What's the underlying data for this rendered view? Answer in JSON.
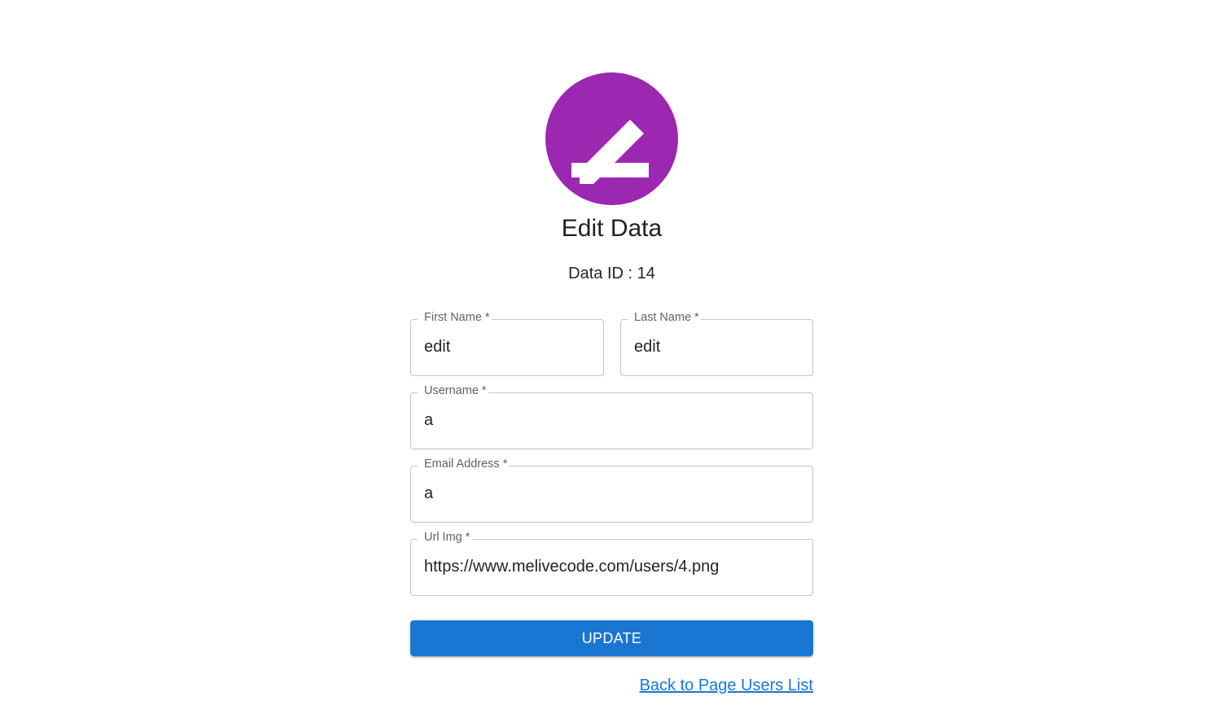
{
  "header": {
    "icon": "edit-icon",
    "title": "Edit Data",
    "data_id_text": "Data ID : 14"
  },
  "form": {
    "first_name": {
      "label": "First Name *",
      "value": "edit"
    },
    "last_name": {
      "label": "Last Name *",
      "value": "edit"
    },
    "username": {
      "label": "Username *",
      "value": "a"
    },
    "email": {
      "label": "Email Address *",
      "value": "a"
    },
    "url_img": {
      "label": "Url Img *",
      "value": "https://www.melivecode.com/users/4.png"
    },
    "update_label": "UPDATE"
  },
  "footer": {
    "back_link": "Back to Page Users List"
  },
  "colors": {
    "avatar": "#9c27b0",
    "primary": "#1976d2",
    "border": "#c4c4c4"
  }
}
